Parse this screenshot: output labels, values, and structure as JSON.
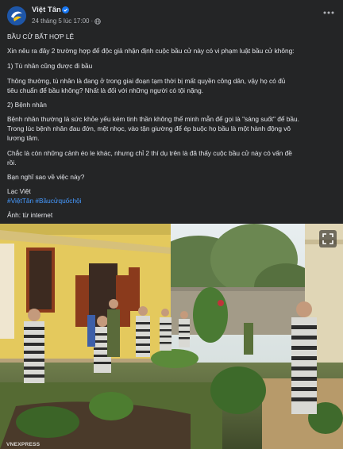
{
  "post": {
    "page_name": "Việt Tân",
    "timestamp": "24 tháng 5 lúc 17:00",
    "separator": "·",
    "icons": {
      "avatar": "viet-tan-logo-icon",
      "verified": "verified-badge-icon",
      "audience": "globe-icon",
      "more": "more-options-icon",
      "expand": "expand-icon"
    },
    "colors": {
      "background": "#242526",
      "text": "#e4e6eb",
      "muted": "#b0b3b8",
      "link": "#4599ff",
      "verified": "#1877f2"
    },
    "lines": {
      "title": "BẦU CỬ BẤT HỢP LỆ",
      "intro": "Xin nêu ra đây 2 trường hợp để độc giả nhận định cuộc bầu cử này có vi phạm luật bầu cử không:",
      "case1_heading": "1) Tù nhân cũng được đi bầu",
      "case1_text_1": "Thông thường, tù nhân là đang ở trong giai đoạn tạm thời bị mất quyền công dân, vậy họ có đủ",
      "case1_text_2": "tiêu chuẩn để bầu không? Nhất là đối với những người có tội nặng.",
      "case2_heading": "2) Bệnh nhân",
      "case2_text_1": "Bệnh nhân thường là sức khỏe yếu kém tinh thần không thể minh mẫn để gọi là \"sáng suốt\" để bầu.",
      "case2_text_2": "Trong lúc bệnh nhân đau đớn, mệt nhọc, vào tận giường để ép buộc họ bầu là một hành động vô",
      "case2_text_3": "lương tâm.",
      "conclusion_1": "Chắc là còn những cảnh éo le khác, nhưng chỉ 2 thí dụ trên là đã thấy cuộc bầu cử này có vấn đề",
      "conclusion_2": "rồi.",
      "question": "Bạn nghĩ sao về việc này?",
      "author": "Lạc Việt",
      "hashtag_1": "#ViệtTân",
      "hashtag_2": "#Bầucửquốchội",
      "photo_credit": "Ảnh: từ internet"
    },
    "photo": {
      "watermark": "VNEXPRESS"
    }
  }
}
